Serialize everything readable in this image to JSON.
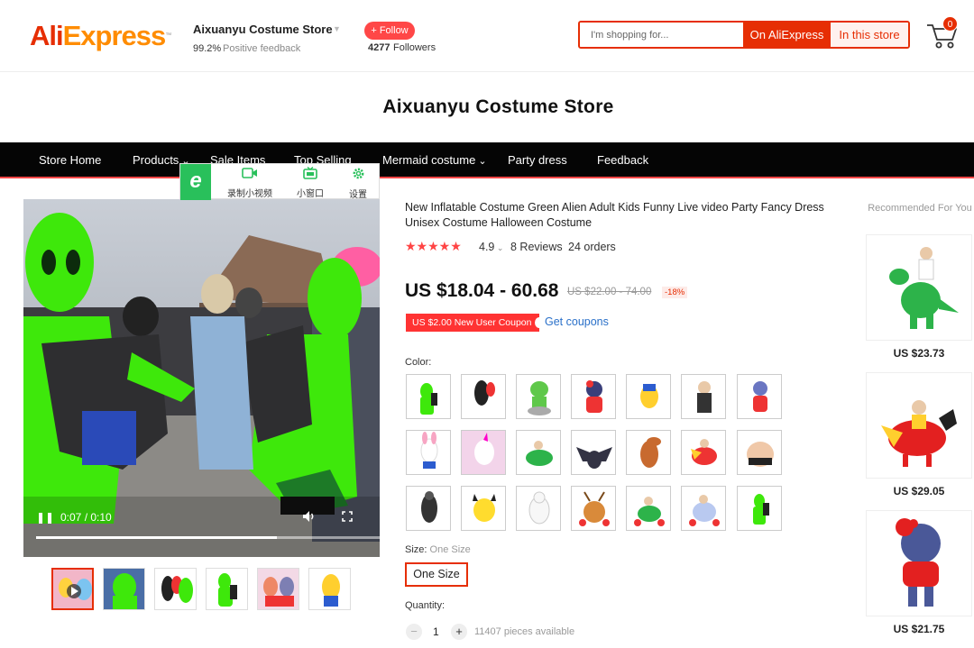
{
  "header": {
    "logo_ali": "Ali",
    "logo_express": "Express",
    "logo_tm": "™",
    "store_name": "Aixuanyu Costume Store",
    "feedback_pct": "99.2%",
    "feedback_label": "Positive feedback",
    "follow_label": "+ Follow",
    "follower_count": "4277",
    "follower_label": "Followers",
    "cart_count": "0"
  },
  "search": {
    "placeholder": "I'm shopping for...",
    "btn_aliexpress": "On AliExpress",
    "btn_store": "In this store"
  },
  "banner": {
    "title": "Aixuanyu Costume Store"
  },
  "nav": {
    "items": [
      {
        "label": "Store Home"
      },
      {
        "label": "Products"
      },
      {
        "label": "Sale Items"
      },
      {
        "label": "Top Selling"
      },
      {
        "label": "Mermaid costume"
      },
      {
        "label": "Party dress"
      },
      {
        "label": "Feedback"
      }
    ]
  },
  "video_toolbar": {
    "record": "录制小视频",
    "mini_window": "小窗口",
    "settings": "设置"
  },
  "video": {
    "time": "0:07 / 0:10",
    "progress": 0.7
  },
  "product": {
    "title": "New Inflatable Costume Green Alien Adult Kids Funny Live video Party Fancy Dress Unisex Costume Halloween Costume",
    "stars": "★★★★★",
    "rating": "4.9",
    "reviews": "8 Reviews",
    "orders": "24 orders",
    "price": "US $18.04 - 60.68",
    "old_price": "US $22.00 - 74.00",
    "discount": "-18%",
    "coupon": "US $2.00 New User Coupon",
    "get_coupons": "Get coupons",
    "color_label": "Color:",
    "size_label": "Size:",
    "size_value": "One Size",
    "size_option": "One Size",
    "quantity_label": "Quantity:",
    "quantity": "1",
    "available": "11407 pieces available"
  },
  "recommended": {
    "title": "Recommended For You",
    "items": [
      {
        "price": "US $23.73"
      },
      {
        "price": "US $29.05"
      },
      {
        "price": "US $21.75"
      }
    ]
  },
  "colors": {
    "brand_red": "#e62e04",
    "brand_orange": "#ff8c00",
    "nav_bg": "#050505",
    "costume_green": "#3ee80b",
    "player_green": "#29c05b",
    "link_blue": "#2a70c9"
  }
}
